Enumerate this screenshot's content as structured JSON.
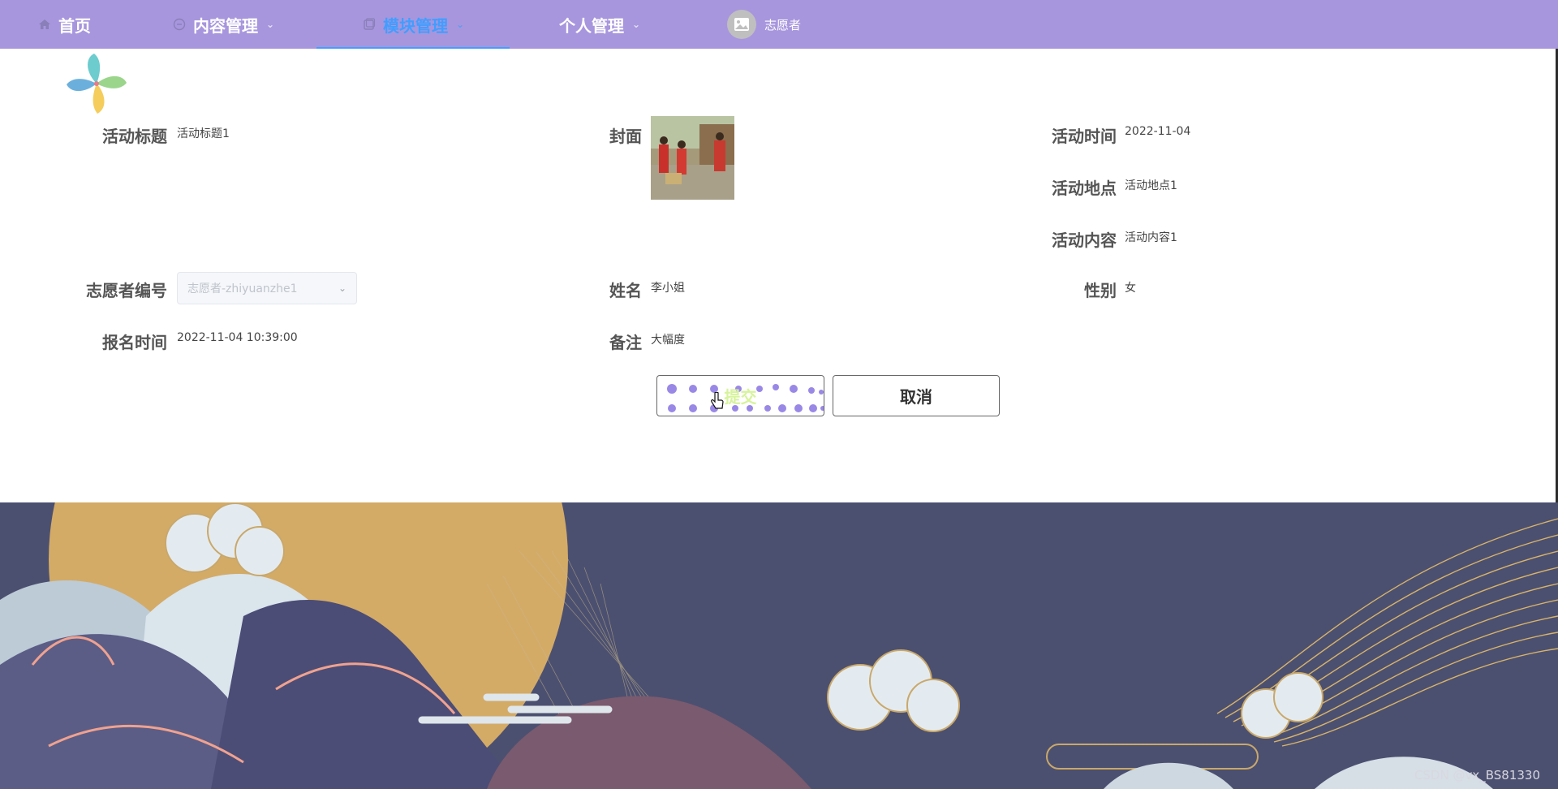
{
  "nav": {
    "items": [
      {
        "label": "首页",
        "icon": "home-icon"
      },
      {
        "label": "内容管理",
        "icon": "content-icon"
      },
      {
        "label": "模块管理",
        "icon": "module-icon",
        "active": true
      },
      {
        "label": "个人管理"
      }
    ],
    "user": {
      "name": "志愿者",
      "avatar": "avatar-image-icon"
    }
  },
  "form": {
    "title_label": "活动标题",
    "title_value": "活动标题1",
    "cover_label": "封面",
    "time_label": "活动时间",
    "time_value": "2022-11-04",
    "location_label": "活动地点",
    "location_value": "活动地点1",
    "content_label": "活动内容",
    "content_value": "活动内容1",
    "volunteer_no_label": "志愿者编号",
    "volunteer_no_placeholder": "志愿者-zhiyuanzhe1",
    "name_label": "姓名",
    "name_value": "李小姐",
    "gender_label": "性别",
    "gender_value": "女",
    "signup_time_label": "报名时间",
    "signup_time_value": "2022-11-04 10:39:00",
    "remark_label": "备注",
    "remark_value": "大幅度"
  },
  "buttons": {
    "submit": "提交",
    "cancel": "取消"
  },
  "watermark": "CSDN @vx_BS81330",
  "colors": {
    "nav_bg": "#a796dd",
    "active": "#409eff",
    "scene_bg": "#4c5070",
    "moon": "#d3ab67"
  }
}
